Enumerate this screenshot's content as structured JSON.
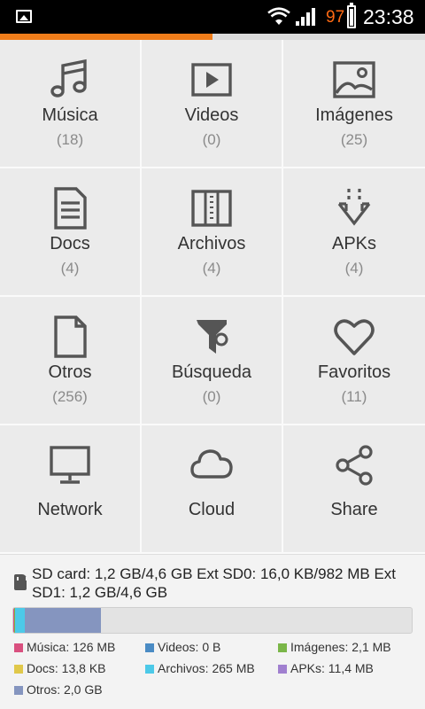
{
  "status_bar": {
    "battery_percent": "97",
    "time": "23:38",
    "icons": [
      "picture-notification-icon",
      "wifi-icon",
      "signal-icon",
      "battery-icon"
    ],
    "battery_color": "#ff6a13"
  },
  "scan_progress": 0.5,
  "accent_color": "#f07d1a",
  "categories": [
    {
      "label": "Música",
      "count": "(18)",
      "icon": "music-note-icon"
    },
    {
      "label": "Videos",
      "count": "(0)",
      "icon": "video-play-icon"
    },
    {
      "label": "Imágenes",
      "count": "(25)",
      "icon": "image-icon"
    },
    {
      "label": "Docs",
      "count": "(4)",
      "icon": "document-icon"
    },
    {
      "label": "Archivos",
      "count": "(4)",
      "icon": "archive-icon"
    },
    {
      "label": "APKs",
      "count": "(4)",
      "icon": "apk-download-icon"
    },
    {
      "label": "Otros",
      "count": "(256)",
      "icon": "blank-file-icon"
    },
    {
      "label": "Búsqueda",
      "count": "(0)",
      "icon": "search-funnel-icon"
    },
    {
      "label": "Favoritos",
      "count": "(11)",
      "icon": "heart-icon"
    },
    {
      "label": "Network",
      "icon": "monitor-icon"
    },
    {
      "label": "Cloud",
      "icon": "cloud-icon"
    },
    {
      "label": "Share",
      "icon": "share-icon"
    }
  ],
  "storage": {
    "summary": "SD card: 1,2 GB/4,6 GB  Ext SD0: 16,0 KB/982 MB  Ext SD1: 1,2 GB/4,6 GB",
    "usage_segments": [
      {
        "name": "Música",
        "fraction": 0.003,
        "color": "#d9507f"
      },
      {
        "name": "Imágenes",
        "fraction": 0.001,
        "color": "#7ab648"
      },
      {
        "name": "Archivos",
        "fraction": 0.025,
        "color": "#4cc9e8"
      },
      {
        "name": "Otros",
        "fraction": 0.19,
        "color": "#8595bf"
      }
    ],
    "legend": [
      {
        "text": "Música: 126 MB",
        "color": "#d9507f"
      },
      {
        "text": "Videos: 0 B",
        "color": "#4a8bc4"
      },
      {
        "text": "Imágenes: 2,1 MB",
        "color": "#7ab648"
      },
      {
        "text": "Docs: 13,8 KB",
        "color": "#e0c84a"
      },
      {
        "text": "Archivos: 265 MB",
        "color": "#4cc9e8"
      },
      {
        "text": "APKs: 11,4 MB",
        "color": "#a07fcf"
      },
      {
        "text": "Otros: 2,0 GB",
        "color": "#8595bf"
      }
    ]
  }
}
